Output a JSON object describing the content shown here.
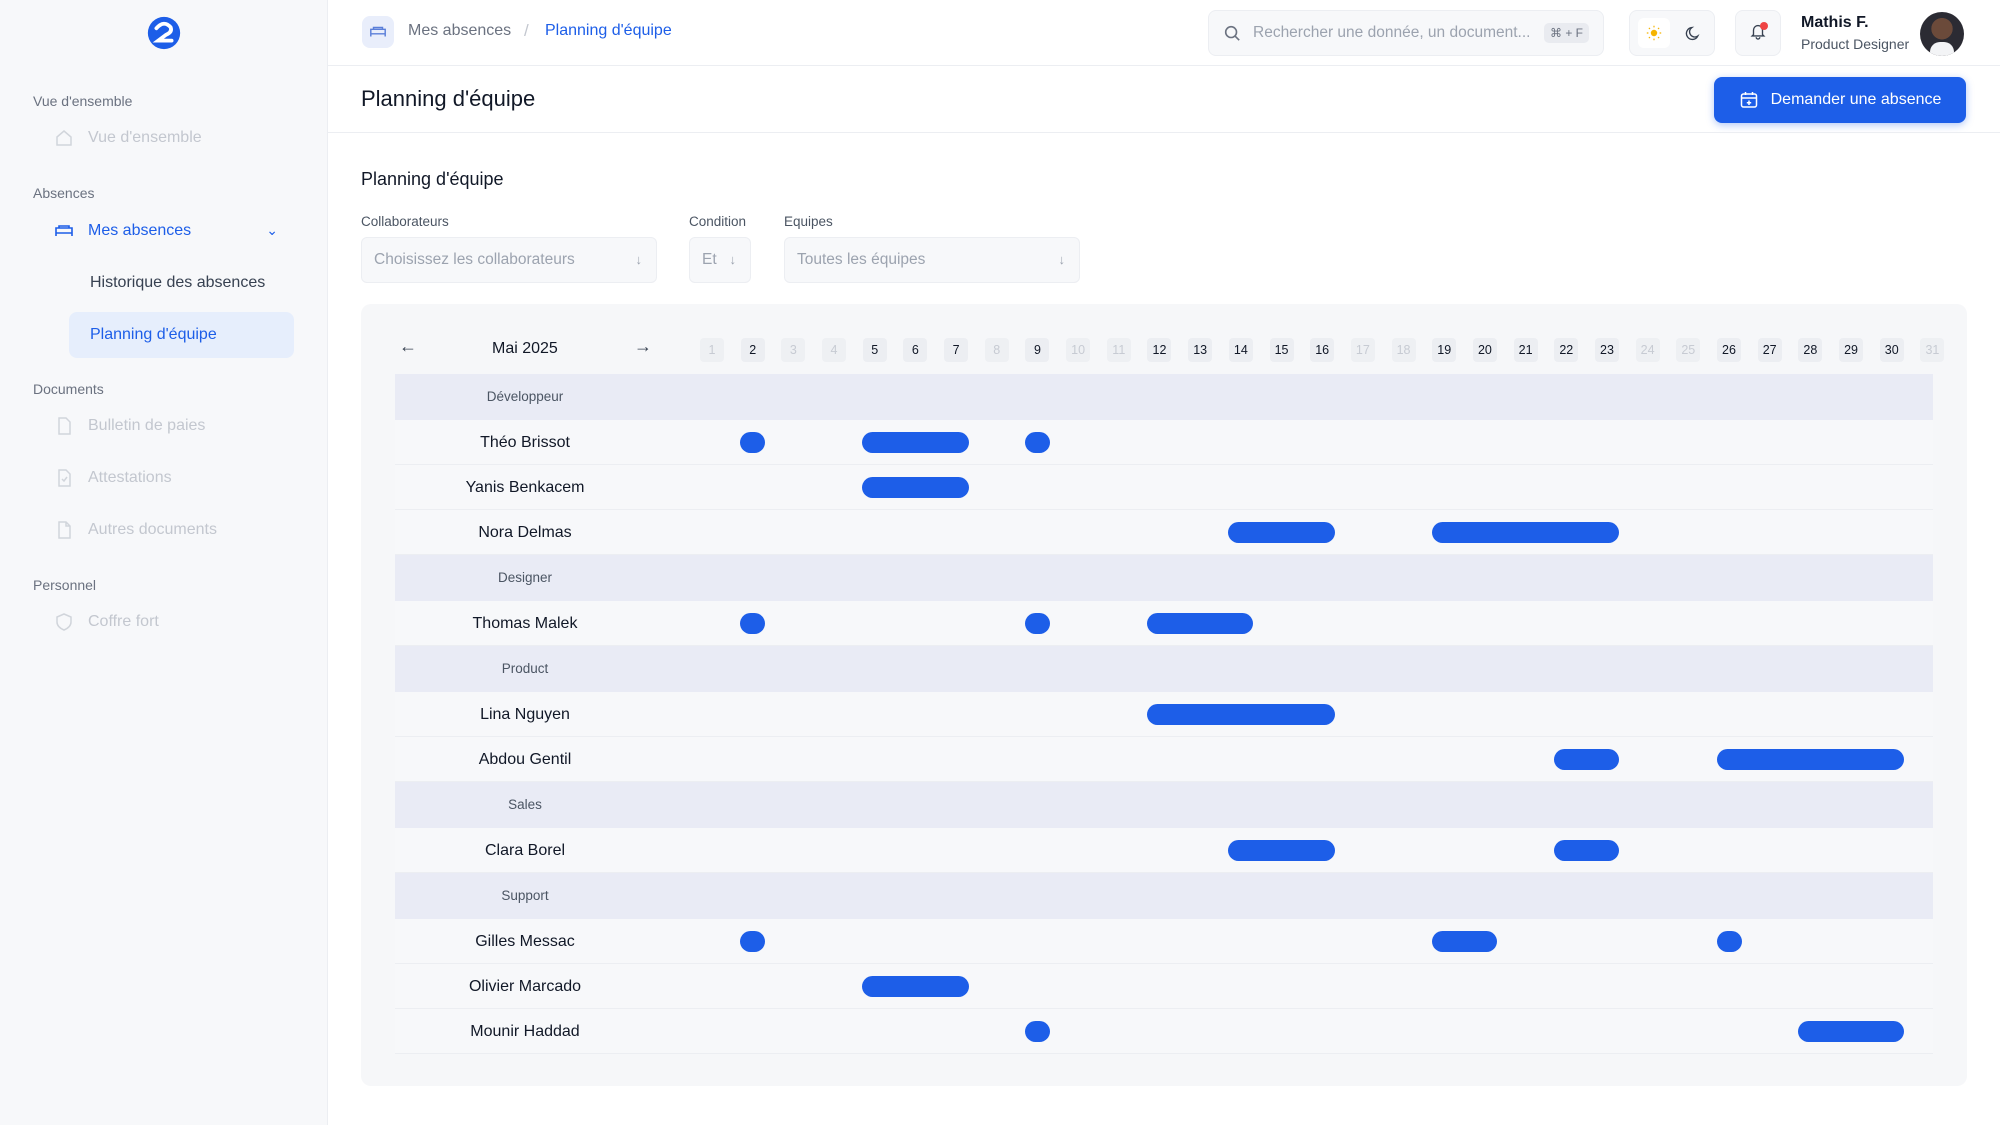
{
  "app": {
    "logo_icon": "brand-logo-icon",
    "accent": "#1d5ee8"
  },
  "sidebar": {
    "sections": [
      {
        "title": "Vue d'ensemble",
        "items": [
          {
            "label": "Vue d'ensemble",
            "icon": "home-icon",
            "state": "disabled"
          }
        ]
      },
      {
        "title": "Absences",
        "items": [
          {
            "label": "Mes absences",
            "icon": "bed-icon",
            "state": "active"
          },
          {
            "label": "Historique des absences",
            "sub": true
          },
          {
            "label": "Planning d'équipe",
            "sub": true,
            "active": true
          }
        ]
      },
      {
        "title": "Documents",
        "items": [
          {
            "label": "Bulletin de paies",
            "icon": "document-icon"
          },
          {
            "label": "Attestations",
            "icon": "document-check-icon"
          },
          {
            "label": "Autres documents",
            "icon": "file-icon"
          }
        ]
      },
      {
        "title": "Personnel",
        "items": [
          {
            "label": "Coffre fort",
            "icon": "shield-icon"
          }
        ]
      }
    ]
  },
  "topbar": {
    "breadcrumb": [
      "Mes absences",
      "Planning d'équipe"
    ],
    "search_placeholder": "Rechercher une donnée, un document...",
    "search_shortcut": "⌘ + F",
    "user_name": "Mathis F.",
    "user_role": "Product Designer"
  },
  "page": {
    "title": "Planning d'équipe",
    "cta": "Demander une absence",
    "section_title": "Planning d'équipe",
    "filters": [
      {
        "label": "Collaborateurs",
        "value": "Choisissez les collaborateurs"
      },
      {
        "label": "Condition",
        "value": "Et"
      },
      {
        "label": "Equipes",
        "value": "Toutes les équipes"
      }
    ]
  },
  "calendar": {
    "month": "Mai 2025",
    "days": [
      1,
      2,
      3,
      4,
      5,
      6,
      7,
      8,
      9,
      10,
      11,
      12,
      13,
      14,
      15,
      16,
      17,
      18,
      19,
      20,
      21,
      22,
      23,
      24,
      25,
      26,
      27,
      28,
      29,
      30,
      31
    ],
    "off_days": [
      1,
      3,
      4,
      8,
      10,
      11,
      17,
      18,
      24,
      25,
      31
    ],
    "groups": [
      {
        "name": "Développeur",
        "people": [
          {
            "name": "Théo Brissot",
            "absences": [
              [
                2,
                2
              ],
              [
                5,
                7
              ],
              [
                9,
                9
              ]
            ]
          },
          {
            "name": "Yanis Benkacem",
            "absences": [
              [
                5,
                7
              ]
            ]
          },
          {
            "name": "Nora Delmas",
            "absences": [
              [
                14,
                16
              ],
              [
                19,
                23
              ]
            ]
          }
        ]
      },
      {
        "name": "Designer",
        "people": [
          {
            "name": "Thomas Malek",
            "absences": [
              [
                2,
                2
              ],
              [
                9,
                9
              ],
              [
                12,
                14
              ]
            ]
          }
        ]
      },
      {
        "name": "Product",
        "people": [
          {
            "name": "Lina Nguyen",
            "absences": [
              [
                12,
                16
              ]
            ]
          },
          {
            "name": "Abdou Gentil",
            "absences": [
              [
                22,
                23
              ],
              [
                26,
                30
              ]
            ]
          }
        ]
      },
      {
        "name": "Sales",
        "people": [
          {
            "name": "Clara Borel",
            "absences": [
              [
                14,
                16
              ],
              [
                22,
                23
              ]
            ]
          }
        ]
      },
      {
        "name": "Support",
        "people": [
          {
            "name": "Gilles Messac",
            "absences": [
              [
                2,
                2
              ],
              [
                19,
                20
              ],
              [
                26,
                26
              ]
            ]
          },
          {
            "name": "Olivier Marcado",
            "absences": [
              [
                5,
                7
              ]
            ]
          },
          {
            "name": "Mounir Haddad",
            "absences": [
              [
                9,
                9
              ],
              [
                28,
                30
              ]
            ]
          }
        ]
      }
    ]
  }
}
